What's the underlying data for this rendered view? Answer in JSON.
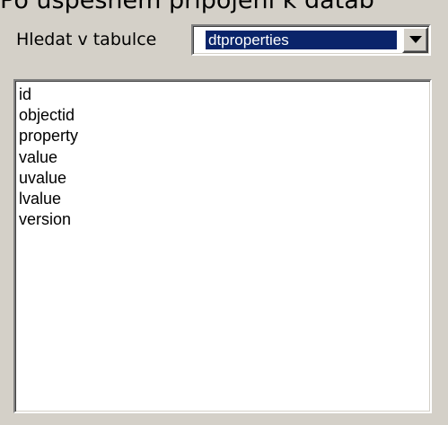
{
  "heading_partial": "Po úspěšném připojení k datab",
  "search": {
    "label": "Hledat v tabulce",
    "selected_table": "dtproperties",
    "dropdown_icon": "chevron-down-icon"
  },
  "columns": {
    "items": [
      "id",
      "objectid",
      "property",
      "value",
      "uvalue",
      "lvalue",
      "version"
    ]
  },
  "colors": {
    "window_bg": "#d4d0c8",
    "selection_bg": "#0a246a",
    "selection_text": "#ffffff"
  }
}
